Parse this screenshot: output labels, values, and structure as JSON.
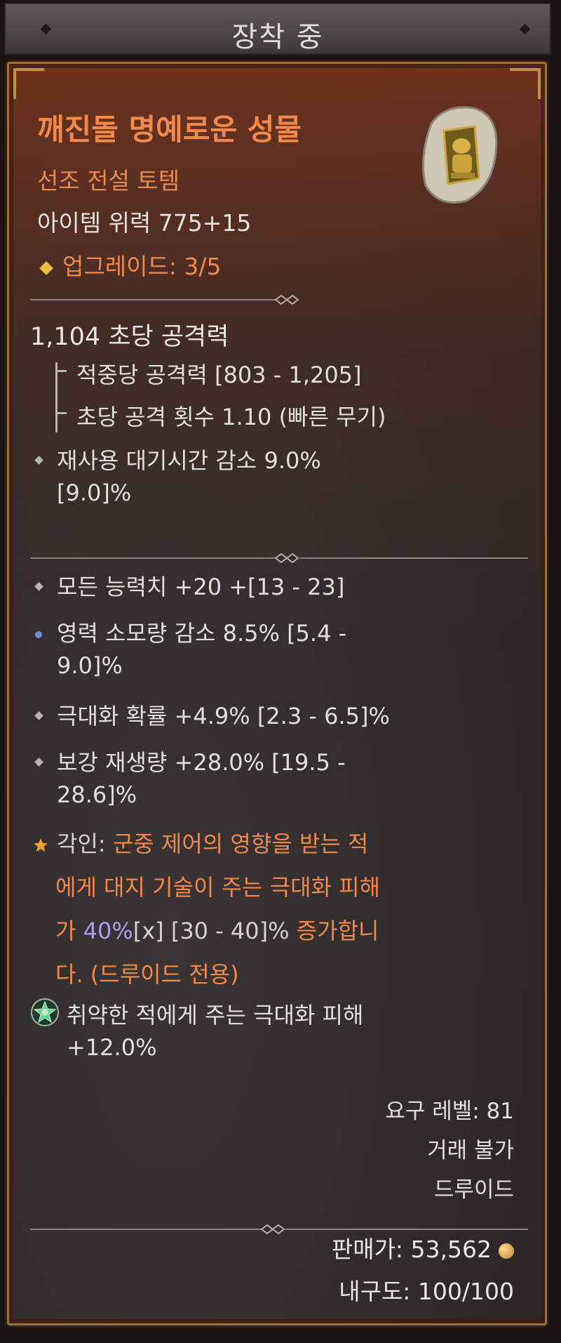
{
  "header": {
    "title": "장착 중"
  },
  "item": {
    "name": "깨진돌 명예로운 성물",
    "type": "선조 전설 토템",
    "power": "아이템 위력 775+15",
    "upgrade": "업그레이드: 3/5",
    "icon": "totem-icon"
  },
  "stats": {
    "dps": "1,104 초당 공격력",
    "damage_per_hit": "적중당 공격력 [803 - 1,205]",
    "attacks_per_second": "초당 공격 횟수 1.10 (빠른 무기)",
    "cdr_line1": "재사용 대기시간 감소 9.0%",
    "cdr_line2": "[9.0]%"
  },
  "affixes": [
    {
      "line1": "모든 능력치 +20 +[13 - 23]"
    },
    {
      "line1": "영력 소모량 감소 8.5% [5.4 -",
      "line2": "9.0]%"
    },
    {
      "line1": "극대화 확률 +4.9% [2.3 - 6.5]%"
    },
    {
      "line1": "보강 재생량 +28.0% [19.5 -",
      "line2": "28.6]%"
    }
  ],
  "aspect": {
    "label": "각인:",
    "text1": "군중 제어의 영향을 받는 적",
    "text2": "에게 대지 기술이 주는 극대화 피해",
    "text3a": "가",
    "value": "40%",
    "text3b": "[x] [30 - 40]%",
    "text3c": "증가합니",
    "text4": "다. (드루이드 전용)"
  },
  "socket": {
    "line1": "취약한 적에게 주는 극대화 피해",
    "line2": "+12.0%",
    "icon": "gem-socket-icon"
  },
  "requirements": {
    "level": "요구 레벨: 81",
    "trade": "거래 불가",
    "class": "드루이드"
  },
  "footer": {
    "sell_price": "판매가: 53,562",
    "durability": "내구도: 100/100"
  },
  "colors": {
    "legendary": "#f2894a",
    "aspect_value": "#a99ef0",
    "text": "#e4dfda"
  }
}
